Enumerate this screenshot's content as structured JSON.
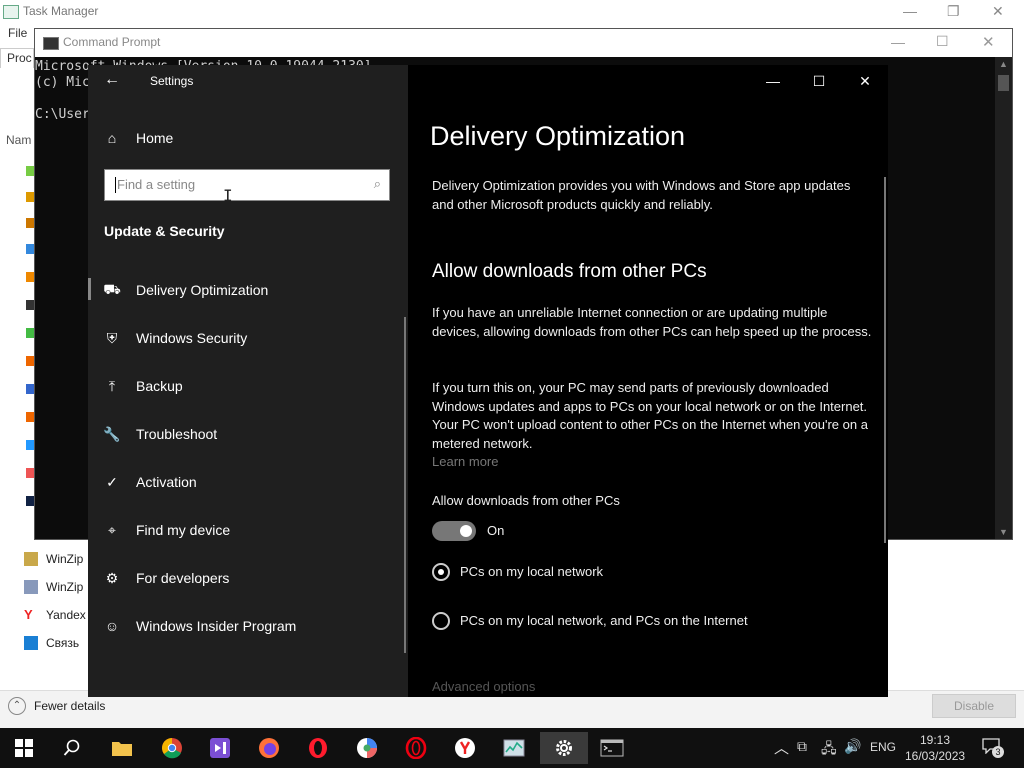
{
  "taskmanager": {
    "title": "Task Manager",
    "menu_file": "File",
    "tab_processes": "Proc",
    "col_name": "Nam",
    "rows": [
      {
        "label": "WinZip"
      },
      {
        "label": "WinZip"
      },
      {
        "label": "Yandex"
      },
      {
        "label": "Связь"
      }
    ],
    "fewer_details": "Fewer details",
    "disable_button": "Disable"
  },
  "cmd": {
    "title": "Command Prompt",
    "line1": "Microsoft Windows [Version 10.0.19044.2130]",
    "line2": "(c) Mic",
    "line3": "C:\\User"
  },
  "settings": {
    "window_title": "Settings",
    "nav": {
      "home": "Home",
      "search_placeholder": "Find a setting",
      "section_title": "Update & Security",
      "items": [
        {
          "label": "Delivery Optimization",
          "icon": "delivery-icon",
          "glyph": "⛟"
        },
        {
          "label": "Windows Security",
          "icon": "shield-icon",
          "glyph": "⛨"
        },
        {
          "label": "Backup",
          "icon": "backup-arrow-icon",
          "glyph": "⤒"
        },
        {
          "label": "Troubleshoot",
          "icon": "wrench-icon",
          "glyph": "🔧"
        },
        {
          "label": "Activation",
          "icon": "checkmark-circle-icon",
          "glyph": "✓"
        },
        {
          "label": "Find my device",
          "icon": "find-device-icon",
          "glyph": "⌖"
        },
        {
          "label": "For developers",
          "icon": "developer-tools-icon",
          "glyph": "⚙"
        },
        {
          "label": "Windows Insider Program",
          "icon": "insider-cat-icon",
          "glyph": "☺"
        }
      ]
    },
    "content": {
      "page_title": "Delivery Optimization",
      "intro": "Delivery Optimization provides you with Windows and Store app updates and other Microsoft products quickly and reliably.",
      "section_heading": "Allow downloads from other PCs",
      "para1": "If you have an unreliable Internet connection or are updating multiple devices, allowing downloads from other PCs can help speed up the process.",
      "para2": "If you turn this on, your PC may send parts of previously downloaded Windows updates and apps to PCs on your local network or on the Internet. Your PC won't upload content to other PCs on the Internet when you're on a metered network.",
      "learn_more": "Learn more",
      "toggle_label": "Allow downloads from other PCs",
      "toggle_state": "On",
      "radio_local": "PCs on my local network",
      "radio_internet": "PCs on my local network, and PCs on the Internet",
      "advanced_options": "Advanced options"
    }
  },
  "taskbar": {
    "language": "ENG",
    "time": "19:13",
    "date": "16/03/2023",
    "notification_count": "3"
  }
}
